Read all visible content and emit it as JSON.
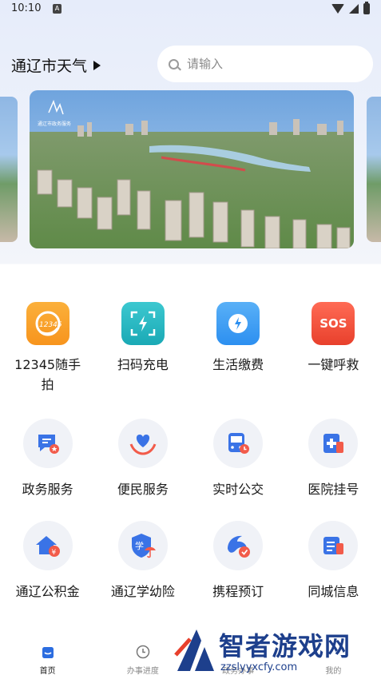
{
  "status_bar": {
    "time": "10:10",
    "notification_icon": "A"
  },
  "header": {
    "weather_label": "通辽市天气",
    "search": {
      "placeholder": "请输入"
    }
  },
  "banner": {
    "caption": "通辽市政务服务",
    "active_page": 2
  },
  "services": [
    {
      "label": "12345随手拍",
      "icon": "camera-report-icon",
      "color": "#f7941d"
    },
    {
      "label": "扫码充电",
      "icon": "scan-charge-icon",
      "color": "#22b8c2"
    },
    {
      "label": "生活缴费",
      "icon": "water-drop-icon",
      "color": "#2c8ff0"
    },
    {
      "label": "一键呼救",
      "icon": "sos-icon",
      "color": "#ef4a36"
    }
  ],
  "row2": [
    {
      "label": "政务服务",
      "icon": "gov-service-icon"
    },
    {
      "label": "便民服务",
      "icon": "heart-hands-icon"
    },
    {
      "label": "实时公交",
      "icon": "bus-icon"
    },
    {
      "label": "医院挂号",
      "icon": "hospital-icon"
    }
  ],
  "row3": [
    {
      "label": "通辽公积金",
      "icon": "housing-fund-icon"
    },
    {
      "label": "通辽学幼险",
      "icon": "student-insurance-icon"
    },
    {
      "label": "携程预订",
      "icon": "trip-dolphin-icon"
    },
    {
      "label": "同城信息",
      "icon": "city-info-icon"
    }
  ],
  "nav": {
    "items": [
      {
        "label": "首页",
        "icon": "home-icon",
        "active": true
      },
      {
        "label": "办事进度",
        "icon": "clock-icon",
        "active": false
      },
      {
        "label": "政务办事",
        "icon": "gov-icon",
        "active": false
      },
      {
        "label": "我的",
        "icon": "user-icon",
        "active": false
      }
    ]
  },
  "watermark": {
    "title": "智者游戏网",
    "url": "zzslyyxcfy.com"
  },
  "colors": {
    "accent": "#2c6de0",
    "icon_bg": "#f0f2f7",
    "watermark": "#1d3f8c"
  }
}
